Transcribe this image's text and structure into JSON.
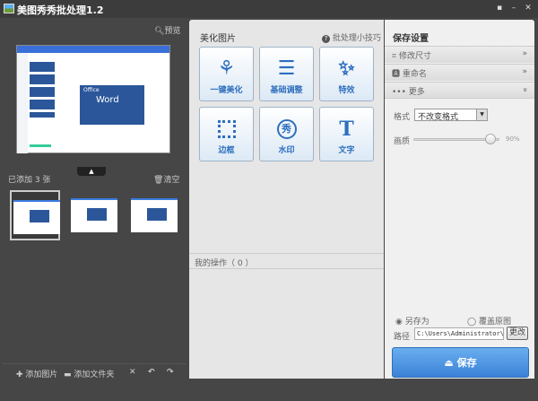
{
  "title": "美图秀秀批处理1.2",
  "left": {
    "preview_label": "预览",
    "added_count": "已添加 3 张",
    "clear_label": "清空",
    "add_image": "添加图片",
    "add_folder": "添加文件夹",
    "preview_content": {
      "office": "Office",
      "word": "Word"
    }
  },
  "middle": {
    "heading": "美化图片",
    "tips": "批处理小技巧",
    "tools": [
      {
        "label": "一键美化",
        "icon": "tulip-icon"
      },
      {
        "label": "基础调整",
        "icon": "sliders-icon"
      },
      {
        "label": "特效",
        "icon": "magic-wand-icon"
      },
      {
        "label": "边框",
        "icon": "frame-icon"
      },
      {
        "label": "水印",
        "icon": "watermark-icon"
      },
      {
        "label": "文字",
        "icon": "text-icon"
      }
    ],
    "ops_label": "我的操作（ 0 ）"
  },
  "right": {
    "heading": "保存设置",
    "sections": [
      "修改尺寸",
      "重命名",
      "更多"
    ],
    "format_label": "格式",
    "format_value": "不改变格式",
    "quality_label": "画质",
    "quality_value": "90%",
    "quality": 90,
    "save_as": "另存为",
    "overwrite": "覆盖原图",
    "path_label": "路径",
    "path_value": "C:\\Users\\Administrator\\De:",
    "change_label": "更改",
    "save_label": "保存"
  },
  "colors": {
    "accent": "#3a82d6",
    "icon": "#2e6fbe"
  }
}
